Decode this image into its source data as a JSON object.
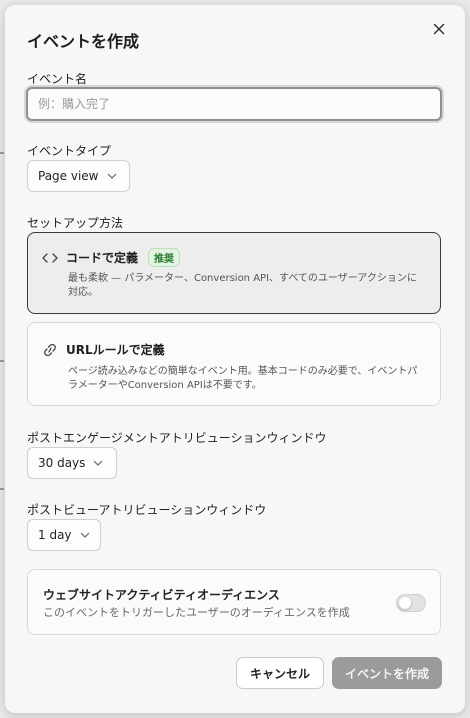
{
  "modal": {
    "title": "イベントを作成",
    "close_icon": "close-icon"
  },
  "event_name": {
    "label": "イベント名",
    "value": "",
    "placeholder": "例：購入完了"
  },
  "event_type": {
    "label": "イベントタイプ",
    "selected": "Page view",
    "icon": "chevron-down-icon"
  },
  "setup_method": {
    "label": "セットアップ方法",
    "options": [
      {
        "icon": "code-icon",
        "title": "コードで定義",
        "badge": "推奨",
        "desc": "最も柔軟 — パラメーター、Conversion API、すべてのユーザーアクションに対応。",
        "selected": true
      },
      {
        "icon": "link-icon",
        "title": "URLルールで定義",
        "desc": "ページ読み込みなどの簡単なイベント用。基本コードのみ必要で、イベントパラメーターやConversion APIは不要です。",
        "selected": false
      }
    ]
  },
  "post_engagement_window": {
    "label": "ポストエンゲージメントアトリビューションウィンドウ",
    "selected": "30 days"
  },
  "post_view_window": {
    "label": "ポストビューアトリビューションウィンドウ",
    "selected": "1 day"
  },
  "website_activity_audience": {
    "title": "ウェブサイトアクティビティオーディエンス",
    "desc": "このイベントをトリガーしたユーザーのオーディエンスを作成",
    "enabled": false
  },
  "actions": {
    "cancel_label": "キャンセル",
    "create_label": "イベントを作成"
  },
  "colors": {
    "selected_card_border": "#3a3a3a",
    "badge_green": "#2e7d32",
    "disabled_primary": "#9b9b9b"
  }
}
